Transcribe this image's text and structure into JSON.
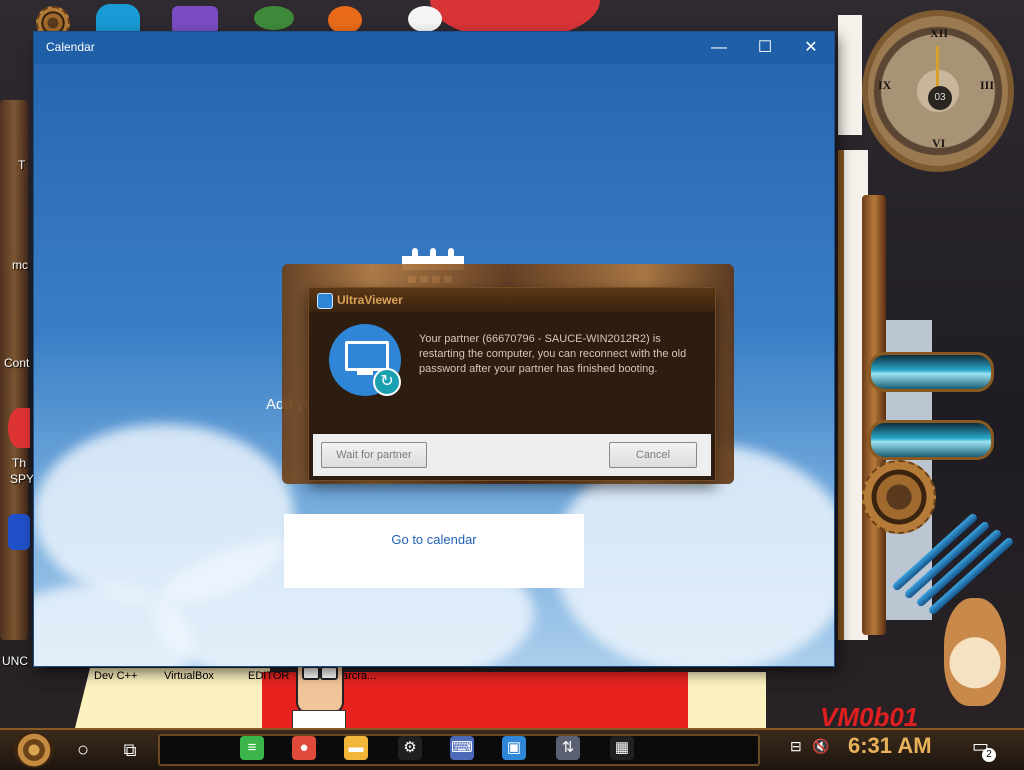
{
  "calendar_window": {
    "title": "Calendar",
    "minimize_glyph": "—",
    "maximize_glyph": "☐",
    "close_glyph": "✕",
    "add_text": "Add yo",
    "go_to_calendar": "Go to calendar"
  },
  "ultraviewer": {
    "title": "UltraViewer",
    "message": "Your partner (66670796 - SAUCE-WIN2012R2) is restarting the computer, you can reconnect with the old password after your partner has finished booting.",
    "wait_button": "Wait for partner",
    "cancel_button": "Cancel",
    "refresh_glyph": "↻"
  },
  "desktop": {
    "left_labels": [
      "T",
      "mc",
      "Cont",
      "Th",
      "SPY",
      "UNC"
    ],
    "bottom_labels": [
      "Dev C++",
      "VirtualBox",
      "EDITOR",
      "Warcra..."
    ],
    "brand_text": "VM0b01",
    "clock_numerals": [
      "XII",
      "III",
      "VI",
      "IX",
      "03"
    ]
  },
  "taskbar": {
    "search_glyph": "○",
    "taskview_glyph": "⧉",
    "apps": [
      {
        "name": "notes-app",
        "glyph": "≡",
        "color": "#3bb54a"
      },
      {
        "name": "chrome",
        "glyph": "●",
        "color": "#e04a3a"
      },
      {
        "name": "file-explorer",
        "glyph": "▬",
        "color": "#f2b63a"
      },
      {
        "name": "settings",
        "glyph": "⚙",
        "color": "#202020"
      },
      {
        "name": "keyboard-app",
        "glyph": "⌨",
        "color": "#4a6ab8"
      },
      {
        "name": "ultraviewer",
        "glyph": "▣",
        "color": "#2f86d6"
      },
      {
        "name": "network-app",
        "glyph": "⇅",
        "color": "#5a6070"
      },
      {
        "name": "calendar",
        "glyph": "▦",
        "color": "#202020"
      }
    ],
    "time": "6:31 AM",
    "notification_count": "2",
    "network_glyph": "⊟",
    "volume_glyph": "🔇"
  }
}
